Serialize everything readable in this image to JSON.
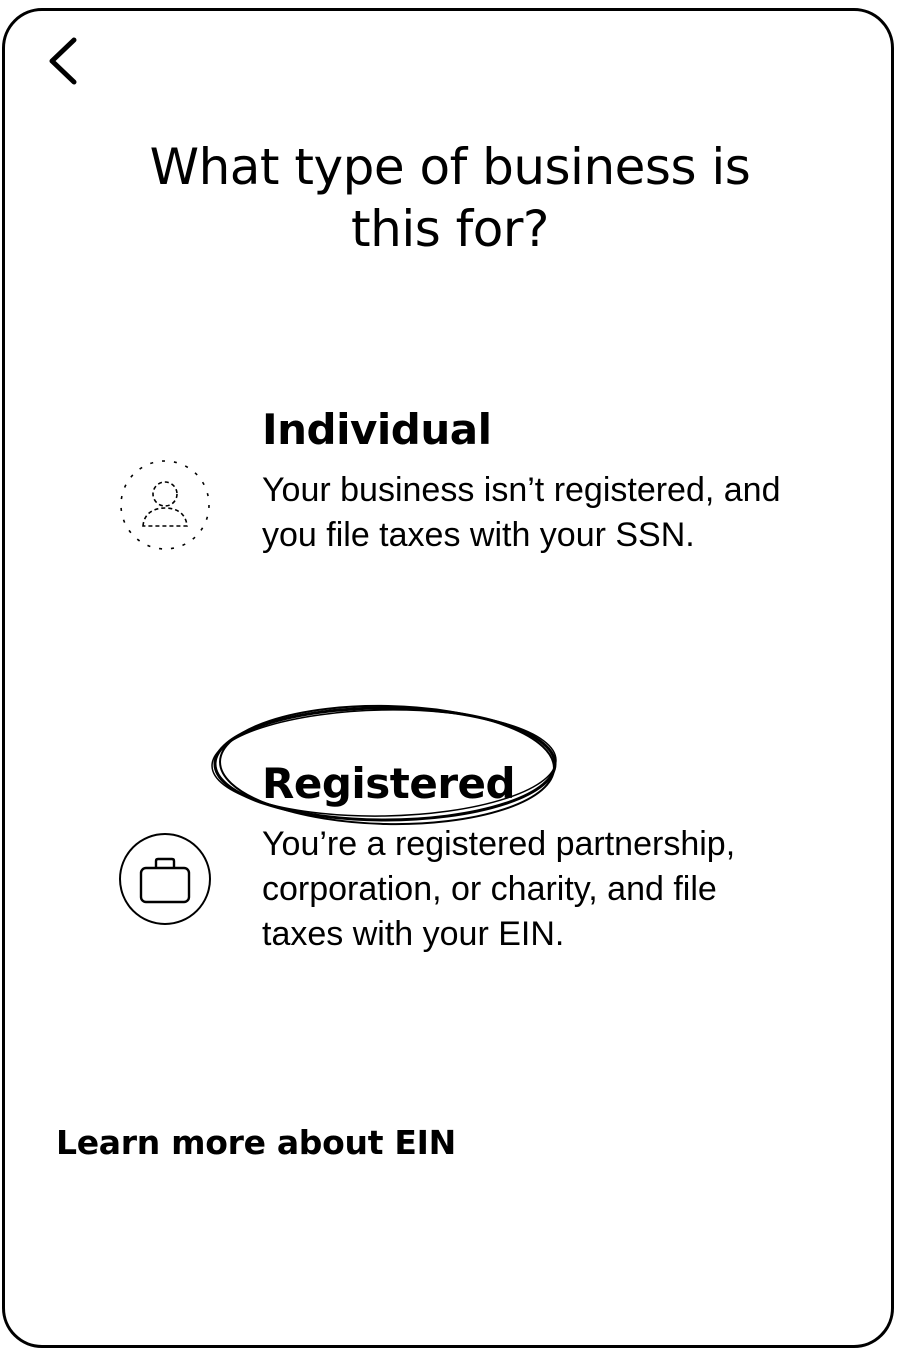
{
  "navigation": {
    "back_icon": "chevron-left-icon"
  },
  "page": {
    "title": "What type of business is this for?"
  },
  "options": [
    {
      "id": "individual",
      "icon": "person-icon",
      "title": "Individual",
      "description": "Your business isn’t registered, and you file taxes with your SSN."
    },
    {
      "id": "registered",
      "icon": "briefcase-icon",
      "title": "Registered",
      "description": "You’re a registered partnership, corporation, or charity, and file taxes with your EIN.",
      "annotated": true
    }
  ],
  "footer": {
    "learn_more_label": "Learn more about EIN"
  },
  "colors": {
    "foreground": "#000000",
    "background": "#ffffff"
  }
}
